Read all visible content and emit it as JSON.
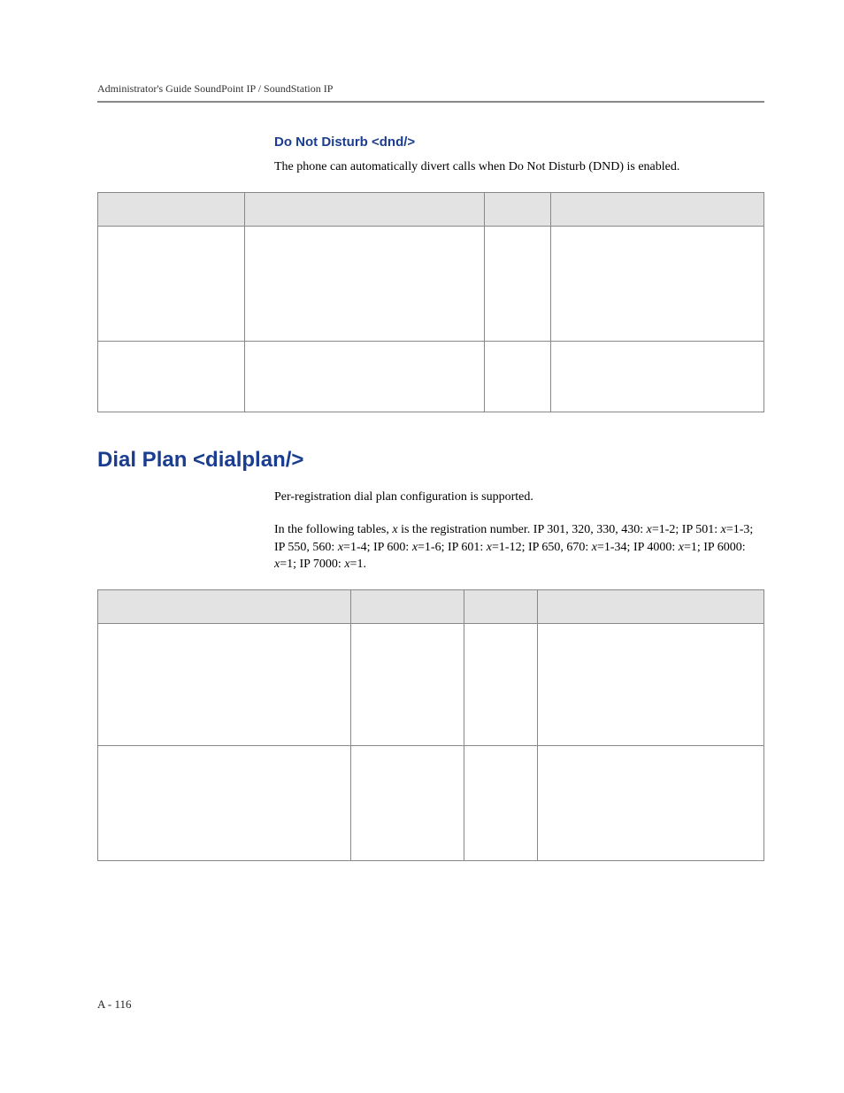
{
  "header": {
    "running": "Administrator's Guide SoundPoint IP / SoundStation IP"
  },
  "dnd": {
    "subtitle": "Do Not Disturb <dnd/>",
    "intro": "The phone can automatically divert calls when Do Not Disturb (DND) is enabled."
  },
  "dialplan": {
    "title": "Dial Plan <dialplan/>",
    "intro": "Per-registration dial plan configuration is supported.",
    "note_prefix": "In the following tables, ",
    "note_var": "x",
    "note_mid1": " is the registration number. IP 301, 320, 330, 430: ",
    "note_v1": "x",
    "note_mid2": "=1-2; IP 501: ",
    "note_v2": "x",
    "note_mid3": "=1-3; IP 550, 560: ",
    "note_v3": "x",
    "note_mid4": "=1-4; IP 600: ",
    "note_v4": "x",
    "note_mid5": "=1-6; IP 601: ",
    "note_v5": "x",
    "note_mid6": "=1-12; IP 650, 670: ",
    "note_v6": "x",
    "note_mid7": "=1-34; IP 4000: ",
    "note_v7": "x",
    "note_mid8": "=1; IP 6000: ",
    "note_v8": "x",
    "note_mid9": "=1; IP 7000: ",
    "note_v9": "x",
    "note_mid10": "=1."
  },
  "footer": {
    "page": "A - 116"
  }
}
